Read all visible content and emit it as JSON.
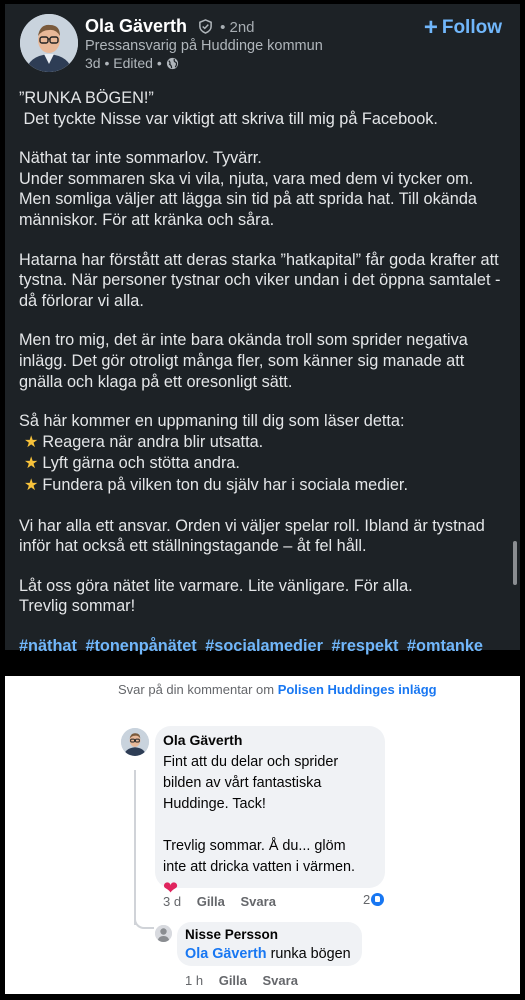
{
  "linkedin_post": {
    "author": {
      "name": "Ola Gäverth",
      "degree": "• 2nd",
      "title": "Pressansvarig på Huddinge kommun",
      "meta": "3d • Edited •"
    },
    "follow_label": "Follow",
    "body": [
      "”RUNKA BÖGEN!”",
      " Det tyckte Nisse var viktigt att skriva till mig på Facebook.",
      "",
      "Näthat tar inte sommarlov. Tyvärr.",
      "Under sommaren ska vi vila, njuta, vara med dem vi tycker om. Men somliga väljer att lägga sin tid på att sprida hat. Till okända människor. För att kränka och såra.",
      "",
      "Hatarna har förstått att deras starka ”hatkapital” får goda krafter att tystna. När personer tystnar och viker undan i det öppna samtalet - då förlorar vi alla.",
      "",
      "Men tro mig, det är inte bara okända troll som sprider negativa inlägg. Det gör otroligt många fler, som känner sig manade att gnälla och klaga på ett oresonligt sätt.",
      "",
      "Så här kommer en uppmaning till dig som läser detta:"
    ],
    "list_items": [
      "Reagera när andra blir utsatta.",
      "Lyft gärna och stötta andra.",
      "Fundera på vilken ton du själv har i sociala medier."
    ],
    "body_end": [
      "Vi har alla ett ansvar. Orden vi väljer spelar roll. Ibland är tystnad inför hat också ett ställningstagande – åt fel håll.",
      "",
      "Låt oss göra nätet lite varmare. Lite vänligare. För alla.",
      "Trevlig sommar!"
    ],
    "hashtags": [
      "#näthat",
      "#tonenpånätet",
      "#socialamedier",
      "#respekt",
      "#omtanke"
    ]
  },
  "facebook": {
    "reply_header_prefix": "Svar på din kommentar om ",
    "reply_header_link": "Polisen Huddinges inlägg",
    "comment1": {
      "name": "Ola Gäverth",
      "line1": "Fint att du delar och sprider",
      "line2": "bilden av vårt fantastiska",
      "line3": "Huddinge. Tack!",
      "line4": "Trevlig sommar. Å du... glöm",
      "line5": "inte att dricka vatten i värmen.",
      "emoji": "❤",
      "time": "3 d",
      "like": "Gilla",
      "reply": "Svara",
      "reactions": "2"
    },
    "comment2": {
      "name": "Nisse Persson",
      "mention": "Ola Gäverth",
      "text": " runka bögen",
      "time": "1 h",
      "like": "Gilla",
      "reply": "Svara"
    }
  }
}
